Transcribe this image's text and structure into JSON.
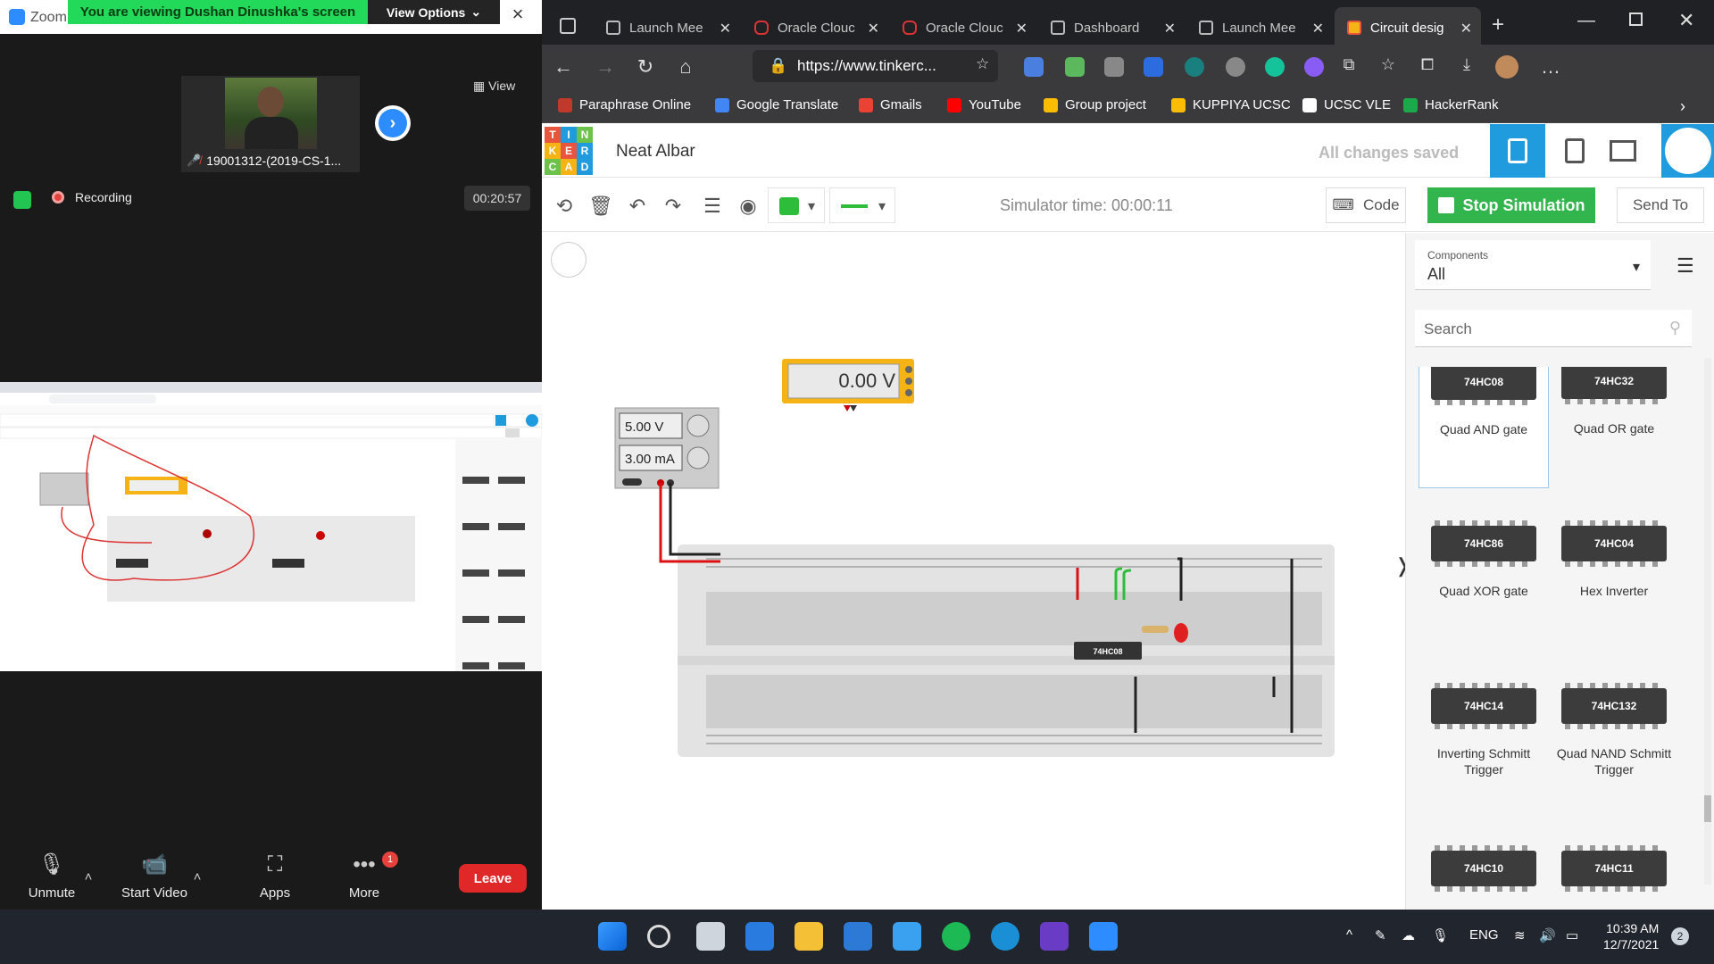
{
  "zoom": {
    "app_name": "Zoom",
    "banner": "You are viewing Dushan Dinushka's screen",
    "view_options": "View Options",
    "view_label": "View",
    "participant": "19001312-(2019-CS-1...",
    "recording": "Recording",
    "timer": "00:20:57",
    "toolbar": [
      {
        "label": "Unmute",
        "icon": "mic-muted-icon"
      },
      {
        "label": "Start Video",
        "icon": "video-off-icon"
      },
      {
        "label": "Apps",
        "icon": "apps-icon"
      },
      {
        "label": "More",
        "icon": "more-icon"
      }
    ],
    "more_badge": "1",
    "leave": "Leave"
  },
  "browser": {
    "tabs": [
      {
        "title": "Launch Mee",
        "icon": "page-icon"
      },
      {
        "title": "Oracle Clouc",
        "icon": "oracle-icon"
      },
      {
        "title": "Oracle Clouc",
        "icon": "oracle-icon"
      },
      {
        "title": "Dashboard",
        "icon": "dashboard-icon"
      },
      {
        "title": "Launch Mee",
        "icon": "page-icon"
      },
      {
        "title": "Circuit desig",
        "icon": "tinkercad-icon"
      }
    ],
    "url": "https://www.tinkerc...",
    "bookmarks": [
      {
        "label": "Paraphrase Online",
        "color": "#c0392b"
      },
      {
        "label": "Google Translate",
        "color": "#4285f4"
      },
      {
        "label": "Gmails",
        "color": "#ea4335"
      },
      {
        "label": "YouTube",
        "color": "#ff0000"
      },
      {
        "label": "Group project",
        "color": "#fbbc04"
      },
      {
        "label": "KUPPIYA UCSC",
        "color": "#fbbc04"
      },
      {
        "label": "UCSC VLE",
        "color": "#ffffff"
      },
      {
        "label": "HackerRank",
        "color": "#1ba94c"
      }
    ]
  },
  "tinkercad": {
    "logo": [
      "T",
      "I",
      "N",
      "K",
      "E",
      "R",
      "C",
      "A",
      "D"
    ],
    "project_name": "Neat Albar",
    "saved_status": "All changes saved",
    "sim_time": "Simulator time: 00:00:11",
    "code_btn": "Code",
    "stop_btn": "Stop Simulation",
    "send_btn": "Send To",
    "multimeter": "0.00 V",
    "power_voltage": "5.00 V",
    "power_current": "3.00 mA",
    "chip_label": "74HC08",
    "components_label": "Components",
    "components_value": "All",
    "search_placeholder": "Search",
    "components": [
      {
        "chip": "74HC08",
        "name": "Quad AND gate"
      },
      {
        "chip": "74HC32",
        "name": "Quad OR gate"
      },
      {
        "chip": "74HC86",
        "name": "Quad XOR gate"
      },
      {
        "chip": "74HC04",
        "name": "Hex Inverter"
      },
      {
        "chip": "74HC14",
        "name": "Inverting Schmitt Trigger"
      },
      {
        "chip": "74HC132",
        "name": "Quad NAND Schmitt Trigger"
      },
      {
        "chip": "74HC10",
        "name": ""
      },
      {
        "chip": "74HC11",
        "name": ""
      }
    ]
  },
  "taskbar": {
    "lang": "ENG",
    "time": "10:39 AM",
    "date": "12/7/2021",
    "notif_count": "2"
  }
}
